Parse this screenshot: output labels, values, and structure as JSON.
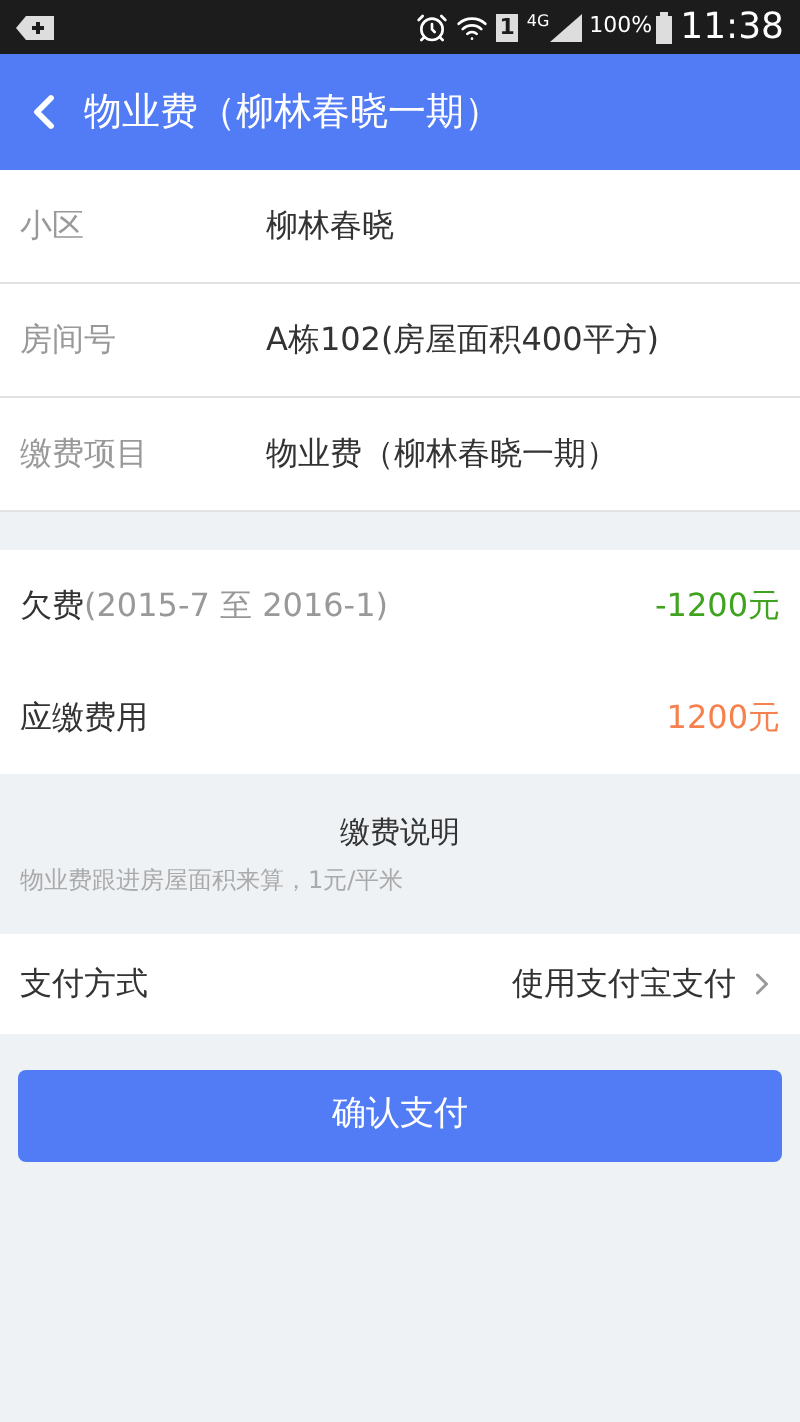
{
  "status_bar": {
    "sim": "1",
    "network": "4G",
    "battery": "100%",
    "time": "11:38"
  },
  "header": {
    "title": "物业费（柳林春晓一期）"
  },
  "info_rows": [
    {
      "label": "小区",
      "value": "柳林春晓"
    },
    {
      "label": "房间号",
      "value": "A栋102(房屋面积400平方)"
    },
    {
      "label": "缴费项目",
      "value": "物业费（柳林春晓一期）"
    }
  ],
  "fees": [
    {
      "label": "欠费",
      "period": "(2015-7 至 2016-1)",
      "amount": "-1200元",
      "color": "#3fa31f"
    },
    {
      "label": "应缴费用",
      "amount": "1200元",
      "color": "#f5814f"
    }
  ],
  "note": {
    "title": "缴费说明",
    "text": "物业费跟进房屋面积来算，1元/平米"
  },
  "payment": {
    "label": "支付方式",
    "value": "使用支付宝支付"
  },
  "confirm_button": "确认支付"
}
